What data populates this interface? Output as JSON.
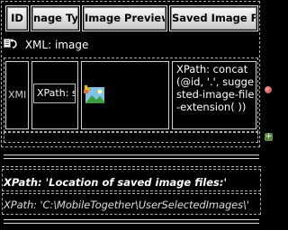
{
  "table": {
    "headers": {
      "id": "ID",
      "type": "nage Typ",
      "preview": "Image Preview",
      "saved": "Saved Image File"
    },
    "xml_label": "XML: image",
    "row": {
      "cell1_text": "XMI",
      "xpath_field": "XPath: s",
      "image_icon": "image-file-icon",
      "saved_xpath": "XPath: concat(@id, '.', suggested-image-file-extension( ))"
    }
  },
  "footer": {
    "note": "XPath: 'Location of saved image files:'",
    "path": "XPath: 'C:\\MobileTogether\\UserSelectedImages\\'"
  }
}
